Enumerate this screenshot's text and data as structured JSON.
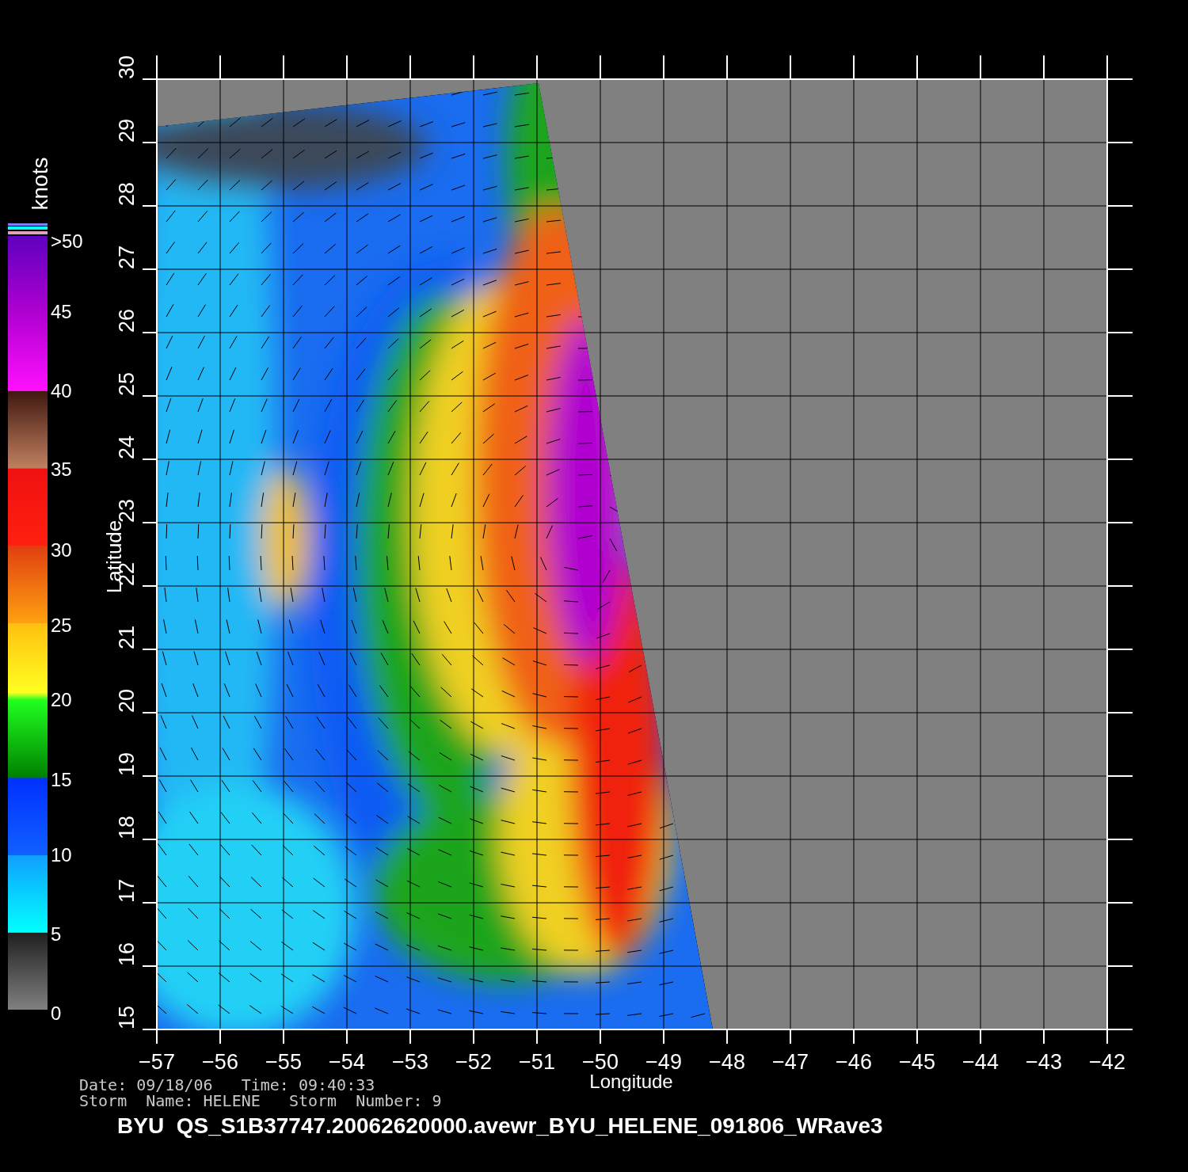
{
  "plot": {
    "xlabel": "Longitude",
    "ylabel": "Latitude",
    "xtick_labels": [
      "−57",
      "−56",
      "−55",
      "−54",
      "−53",
      "−52",
      "−51",
      "−50",
      "−49",
      "−48",
      "−47",
      "−46",
      "−45",
      "−44",
      "−43",
      "−42"
    ],
    "ytick_labels": [
      "15",
      "16",
      "17",
      "18",
      "19",
      "20",
      "21",
      "22",
      "23",
      "24",
      "25",
      "26",
      "27",
      "28",
      "29",
      "30"
    ]
  },
  "colorbar": {
    "unit": "knots",
    "labels": [
      ">50",
      "45",
      "40",
      "35",
      "30",
      "25",
      "20",
      "15",
      "10",
      "5",
      "0"
    ]
  },
  "footer": {
    "date_line": "Date: 09/18/06   Time: 09:40:33",
    "storm_line": "Storm  Name: HELENE   Storm  Number: 9",
    "file_line": "BYU  QS_S1B37747.20062620000.avewr_BYU_HELENE_091806_WRave3"
  }
}
